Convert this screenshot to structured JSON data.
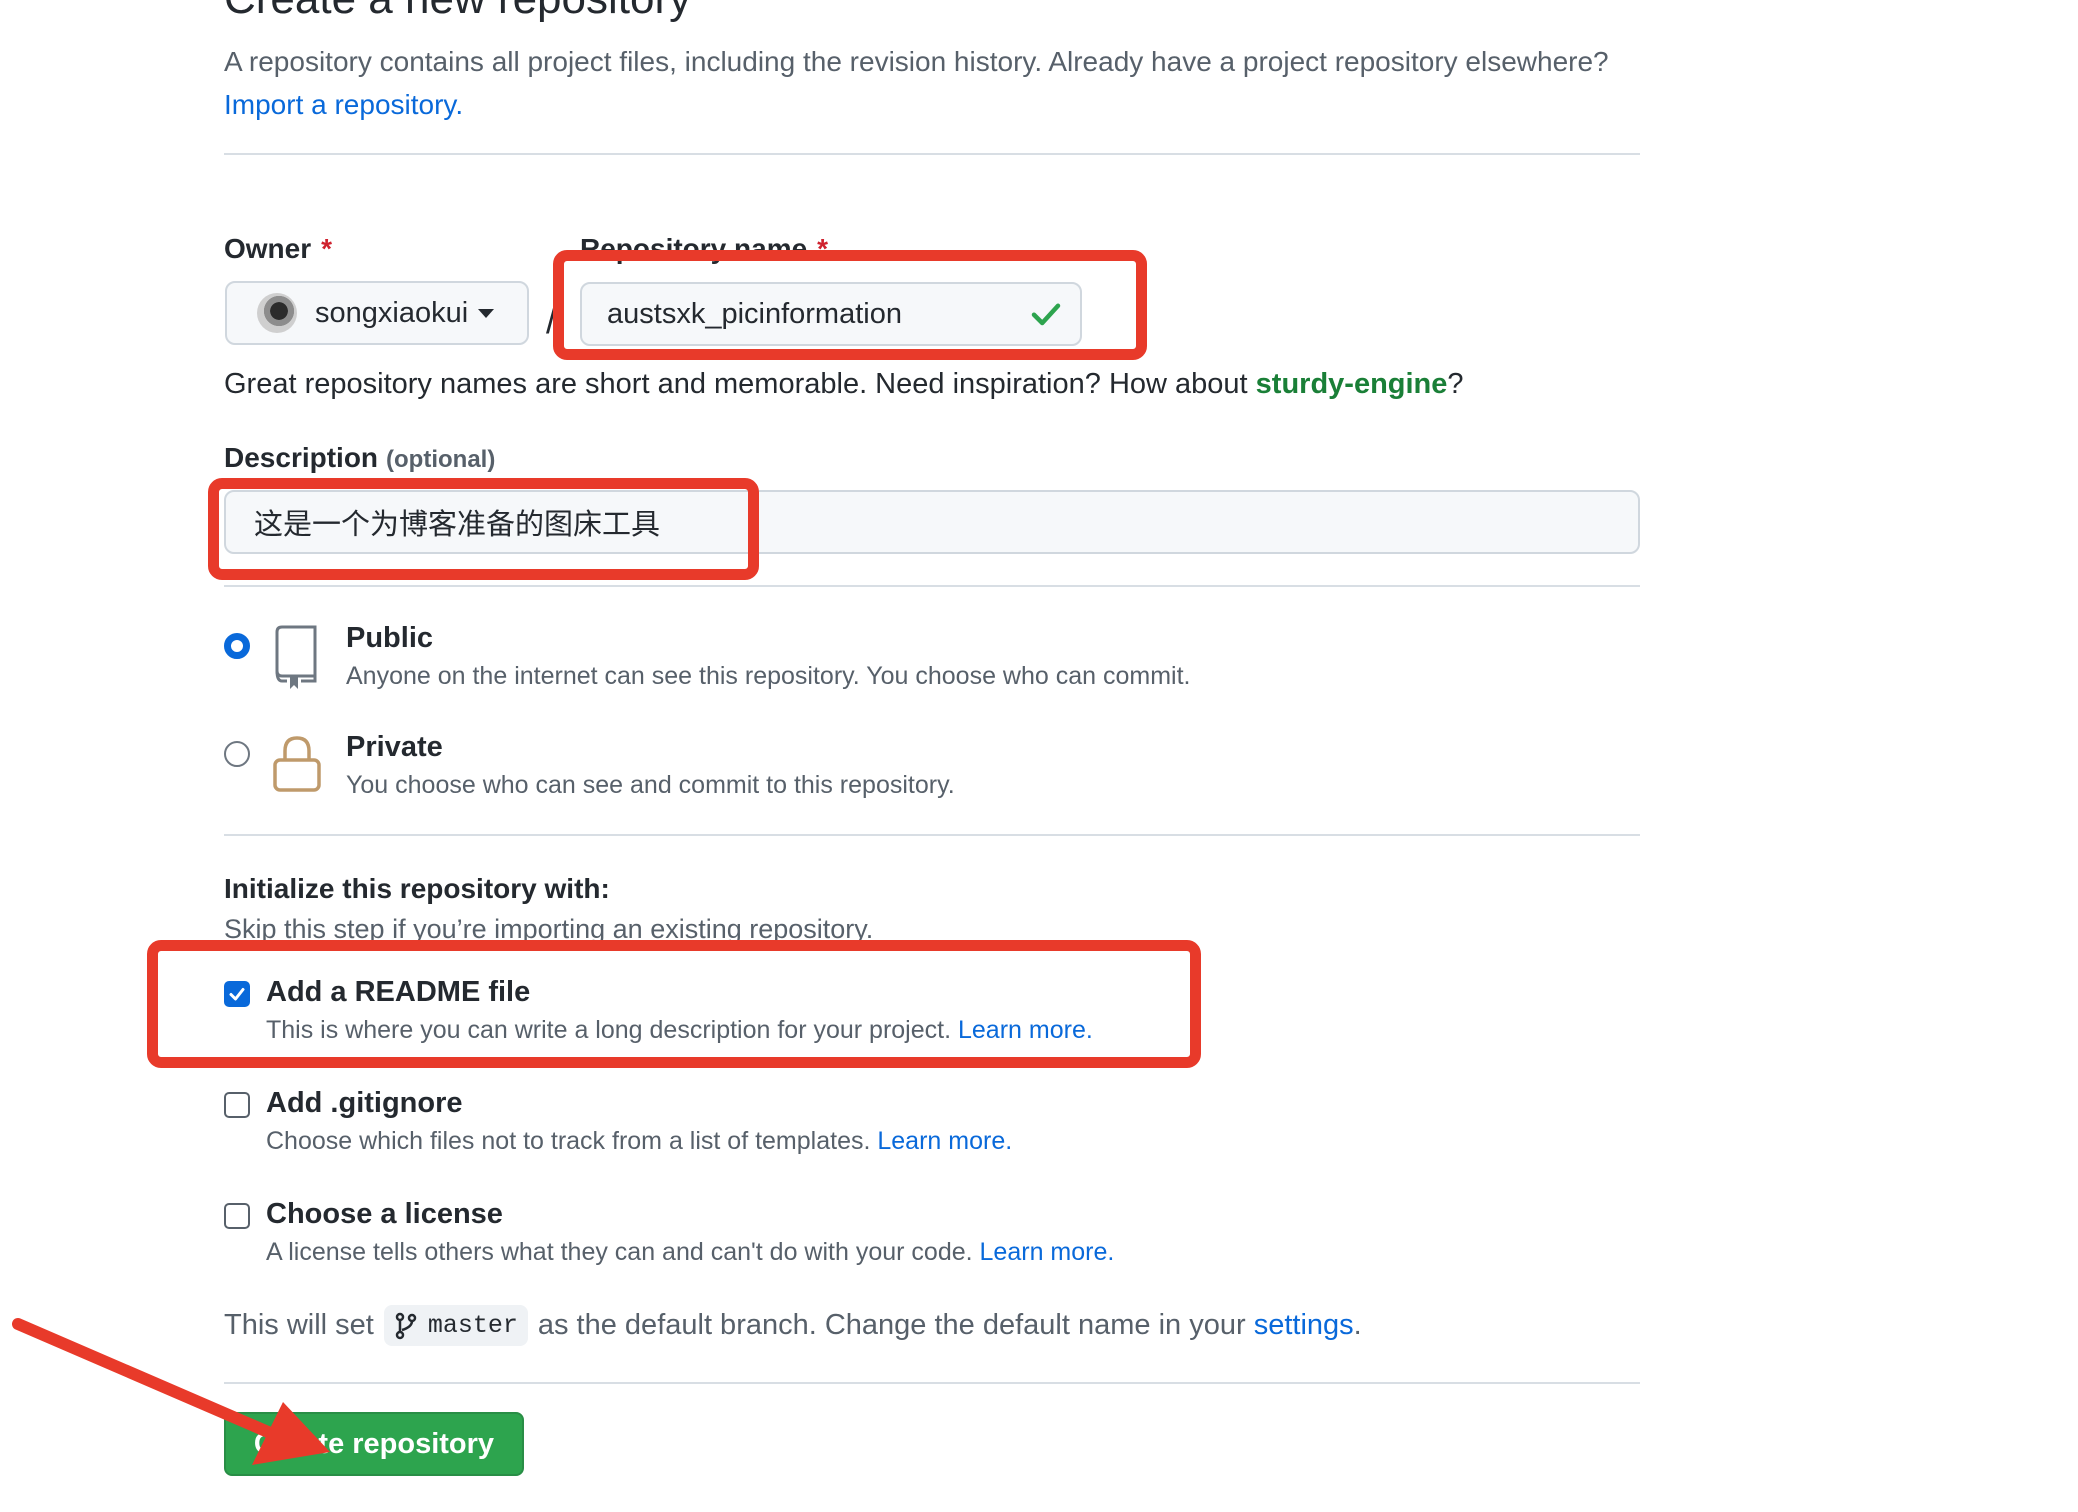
{
  "page": {
    "title": "Create a new repository",
    "intro_text": "A repository contains all project files, including the revision history. Already have a project repository elsewhere?",
    "import_link": "Import a repository."
  },
  "owner": {
    "label": "Owner",
    "required_mark": "*",
    "value": "songxiaokui"
  },
  "repo_name": {
    "label": "Repository name",
    "required_mark": "*",
    "value": "austsxk_picinformation",
    "separator": "/"
  },
  "name_hint": {
    "text": "Great repository names are short and memorable. Need inspiration? How about",
    "suggestion": "sturdy-engine",
    "suffix": "?"
  },
  "description": {
    "label": "Description",
    "optional": "(optional)",
    "value": "这是一个为博客准备的图床工具"
  },
  "visibility": [
    {
      "title": "Public",
      "desc": "Anyone on the internet can see this repository. You choose who can commit.",
      "selected": true,
      "icon": "repo-icon"
    },
    {
      "title": "Private",
      "desc": "You choose who can see and commit to this repository.",
      "selected": false,
      "icon": "lock-icon"
    }
  ],
  "init": {
    "heading": "Initialize this repository with:",
    "skip_text": "Skip this step if you’re importing an existing repository.",
    "options": [
      {
        "title": "Add a README file",
        "desc": "This is where you can write a long description for your project.",
        "link": "Learn more.",
        "checked": true
      },
      {
        "title": "Add .gitignore",
        "desc": "Choose which files not to track from a list of templates.",
        "link": "Learn more.",
        "checked": false
      },
      {
        "title": "Choose a license",
        "desc": "A license tells others what they can and can't do with your code.",
        "link": "Learn more.",
        "checked": false
      }
    ]
  },
  "branch": {
    "prefix": "This will set",
    "name": "master",
    "middle": "as the default branch. Change the default name in your",
    "link": "settings",
    "suffix": "."
  },
  "create_button": "Create repository",
  "colors": {
    "accent": "#0969da",
    "success": "#2da44e",
    "annotation": "#e83a2a"
  }
}
